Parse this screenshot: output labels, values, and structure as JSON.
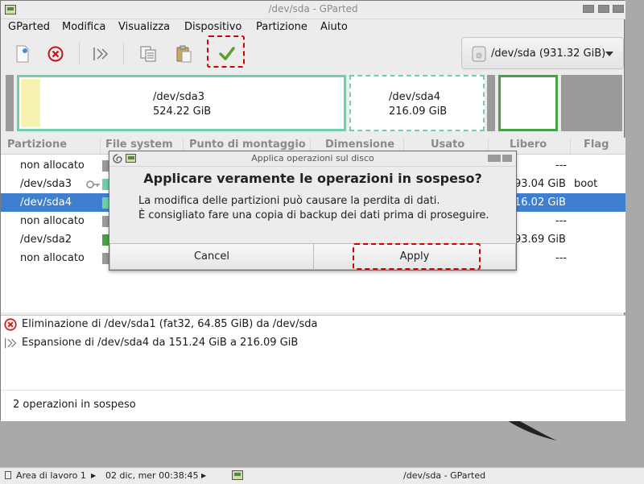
{
  "window": {
    "title": "/dev/sda - GParted"
  },
  "menubar": {
    "items": [
      "GParted",
      "Modifica",
      "Visualizza",
      "Dispositivo",
      "Partizione",
      "Aiuto"
    ]
  },
  "toolbar": {
    "buttons": [
      {
        "icon": "new-partition-icon"
      },
      {
        "icon": "delete-icon"
      },
      {
        "icon": "resize-move-icon"
      },
      {
        "icon": "copy-icon"
      },
      {
        "icon": "paste-icon"
      },
      {
        "icon": "apply-check-icon"
      }
    ]
  },
  "device": {
    "label": "/dev/sda (931.32 GiB)"
  },
  "disk_map": {
    "sda3": {
      "name": "/dev/sda3",
      "size": "524.22 GiB"
    },
    "sda4": {
      "name": "/dev/sda4",
      "size": "216.09 GiB"
    }
  },
  "table": {
    "headers": [
      "Partizione",
      "File system",
      "Punto di montaggio",
      "Dimensione",
      "Usato",
      "Libero",
      "Flag"
    ],
    "rows": [
      {
        "partition": "non allocato",
        "free": "---",
        "flag": ""
      },
      {
        "partition": "/dev/sda3",
        "free": "93.04 GiB",
        "flag": "boot"
      },
      {
        "partition": "/dev/sda4",
        "free": "16.02 GiB",
        "flag": ""
      },
      {
        "partition": "non allocato",
        "free": "---",
        "flag": ""
      },
      {
        "partition": "/dev/sda2",
        "free": "93.69 GiB",
        "flag": ""
      },
      {
        "partition": "non allocato",
        "free": "---",
        "flag": ""
      }
    ]
  },
  "operations": [
    {
      "icon": "delete-icon",
      "text": "Eliminazione di /dev/sda1 (fat32, 64.85 GiB) da /dev/sda"
    },
    {
      "icon": "resize-move-icon",
      "text": "Espansione di /dev/sda4 da 151.24 GiB a 216.09 GiB"
    }
  ],
  "status": {
    "text": "2 operazioni in sospeso"
  },
  "dialog": {
    "title": "Applica operazioni sul disco",
    "heading": "Applicare veramente le operazioni in sospeso?",
    "message_line1": "La modifica delle partizioni può causare la perdita di dati.",
    "message_line2": "È consigliato fare una copia di backup dei dati prima di proseguire.",
    "cancel_label": "Cancel",
    "apply_label": "Apply"
  },
  "taskbar": {
    "workspace": "Area di lavoro 1",
    "datetime": "02 dic, mer 00:38:45",
    "task": "/dev/sda - GParted"
  },
  "colors": {
    "selection": "#3e7fd0",
    "partition_border": "#6fcfa8",
    "ext_green": "#4aa04a",
    "highlight_red": "#d30000"
  }
}
